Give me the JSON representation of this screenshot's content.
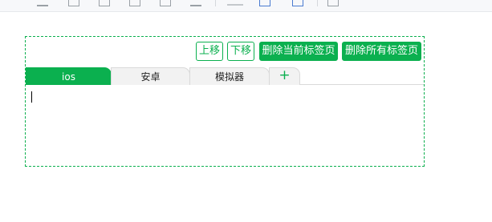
{
  "toolbar": {
    "icons": [
      "align-left-icon",
      "comment-icon",
      "table-icon",
      "copy-icon",
      "document-icon",
      "list-icon",
      "format-icon",
      "image-icon",
      "save-icon",
      "grid-icon"
    ]
  },
  "actions": {
    "move_up": "上移",
    "move_down": "下移",
    "delete_current_tab": "删除当前标签页",
    "delete_all_tabs": "删除所有标签页"
  },
  "tabs": [
    {
      "label": "ios",
      "active": true
    },
    {
      "label": "安卓",
      "active": false
    },
    {
      "label": "模拟器",
      "active": false
    }
  ],
  "add_tab": "+",
  "colors": {
    "accent": "#0bb04f",
    "tab_inactive_bg": "#f2f2f2",
    "border": "#d9d9d9"
  }
}
